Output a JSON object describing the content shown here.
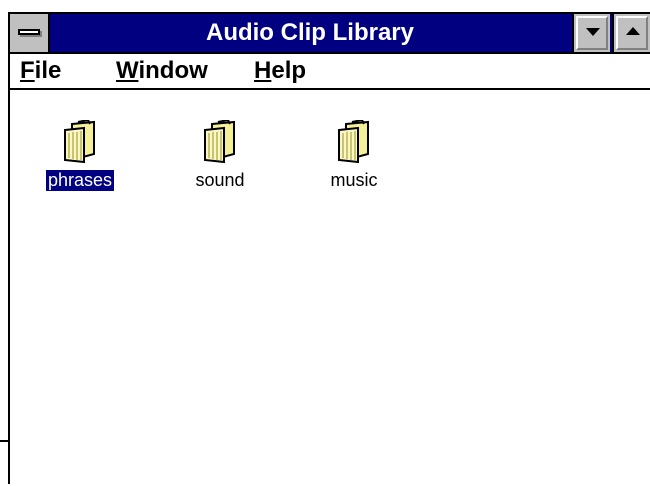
{
  "window": {
    "title": "Audio Clip Library"
  },
  "menu": [
    {
      "label": "ile",
      "mnemonic": "F"
    },
    {
      "label": "indow",
      "mnemonic": "W"
    },
    {
      "label": "elp",
      "mnemonic": "H"
    }
  ],
  "folders": [
    {
      "label": "phrases",
      "icon": "folder-icon",
      "selected": true
    },
    {
      "label": "sound",
      "icon": "folder-icon",
      "selected": false
    },
    {
      "label": "music",
      "icon": "folder-icon",
      "selected": false
    }
  ],
  "colors": {
    "titlebar": "#000080",
    "selection": "#000080",
    "folder": "#f4f09a"
  }
}
